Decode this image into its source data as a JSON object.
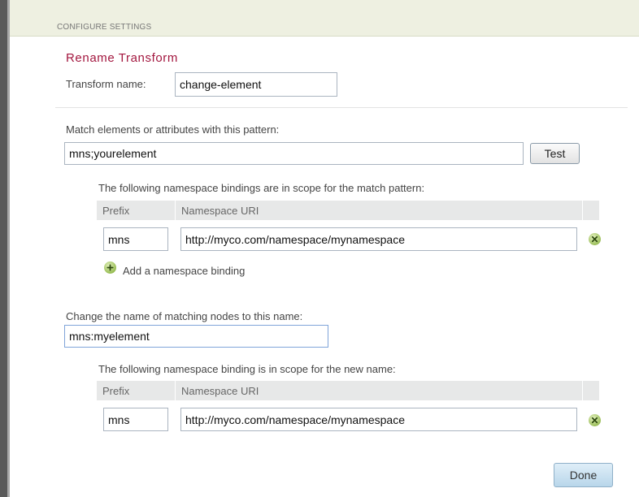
{
  "header": {
    "label": "CONFIGURE SETTINGS"
  },
  "title": "Rename Transform",
  "transform": {
    "label": "Transform name:",
    "value": "change-element"
  },
  "match": {
    "label": "Match elements or attributes with this pattern:",
    "value": "mns;yourelement",
    "test_label": "Test",
    "ns_intro": "The following namespace bindings are in scope for the match pattern:",
    "col_prefix": "Prefix",
    "col_uri": "Namespace URI",
    "rows": [
      {
        "prefix": "mns",
        "uri": "http://myco.com/namespace/mynamespace"
      }
    ],
    "add_label": "Add a namespace binding"
  },
  "rename": {
    "label": "Change the name of matching nodes to this name:",
    "value": "mns:myelement",
    "ns_intro": "The following namespace binding is in scope for the new name:",
    "col_prefix": "Prefix",
    "col_uri": "Namespace URI",
    "rows": [
      {
        "prefix": "mns",
        "uri": "http://myco.com/namespace/mynamespace"
      }
    ]
  },
  "done_label": "Done",
  "icons": {
    "remove": "remove-icon",
    "add": "add-icon"
  },
  "colors": {
    "title": "#a3173f",
    "header_bg": "#eef0e1",
    "icon_green": "#9cbf5a"
  }
}
